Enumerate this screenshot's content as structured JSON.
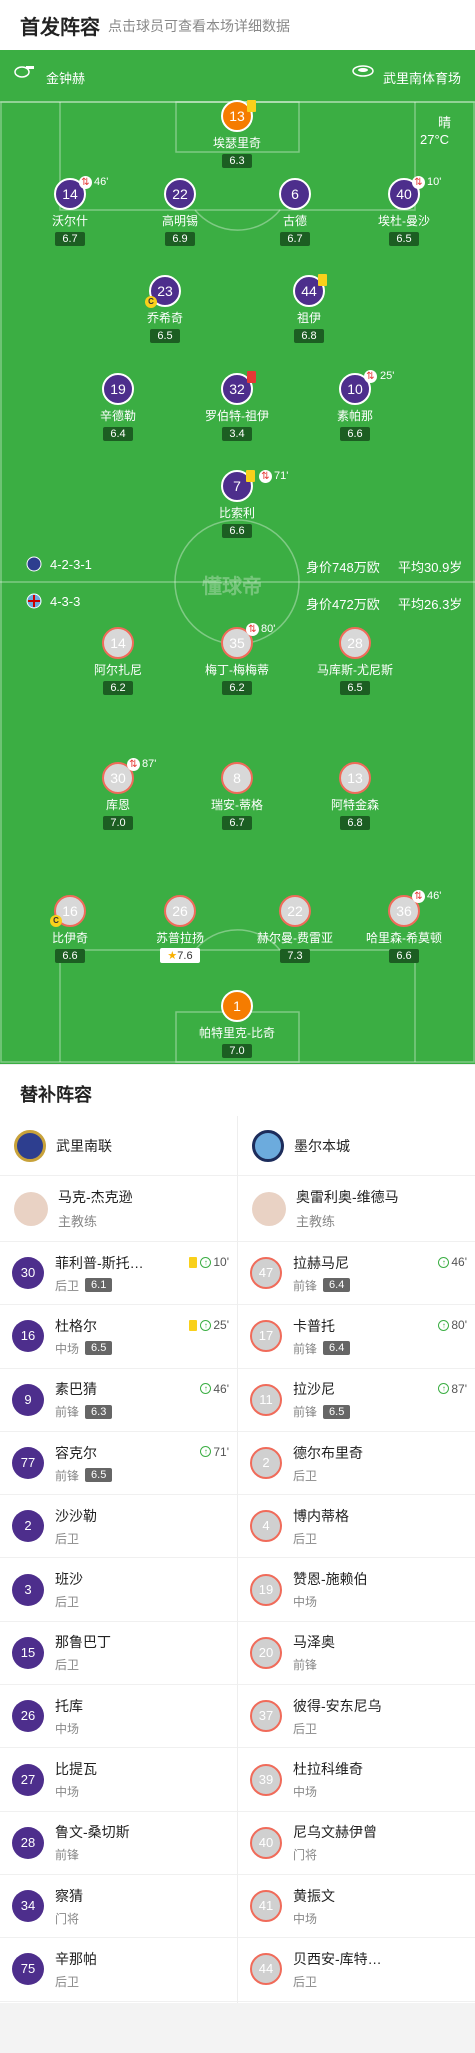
{
  "header": {
    "title": "首发阵容",
    "subtitle": "点击球员可查看本场详细数据"
  },
  "pitch": {
    "home_coach": "金钟赫",
    "stadium": "武里南体育场",
    "weather": "晴",
    "temperature": "27°C",
    "home_formation": "4-2-3-1",
    "home_value": "身价748万欧",
    "home_age": "平均30.9岁",
    "away_formation": "4-3-3",
    "away_value": "身价472万欧",
    "away_age": "平均26.3岁",
    "watermark": "懂球帝"
  },
  "home_players": [
    {
      "num": "13",
      "name": "埃瑟里奇",
      "rating": "6.3"
    },
    {
      "num": "14",
      "name": "沃尔什",
      "rating": "6.7",
      "sub": "46'"
    },
    {
      "num": "22",
      "name": "高明锡",
      "rating": "6.9"
    },
    {
      "num": "6",
      "name": "古德",
      "rating": "6.7"
    },
    {
      "num": "40",
      "name": "埃杜-曼沙",
      "rating": "6.5",
      "sub": "10'"
    },
    {
      "num": "23",
      "name": "乔希奇",
      "rating": "6.5"
    },
    {
      "num": "44",
      "name": "祖伊",
      "rating": "6.8"
    },
    {
      "num": "19",
      "name": "辛德勒",
      "rating": "6.4"
    },
    {
      "num": "32",
      "name": "罗伯特-祖伊",
      "rating": "3.4"
    },
    {
      "num": "10",
      "name": "素帕那",
      "rating": "6.6",
      "sub": "25'"
    },
    {
      "num": "7",
      "name": "比索利",
      "rating": "6.6",
      "sub": "71'"
    }
  ],
  "away_players": [
    {
      "num": "14",
      "name": "阿尔扎尼",
      "rating": "6.2"
    },
    {
      "num": "35",
      "name": "梅丁-梅梅蒂",
      "rating": "6.2",
      "sub": "80'"
    },
    {
      "num": "28",
      "name": "马库斯-尤尼斯",
      "rating": "6.5"
    },
    {
      "num": "30",
      "name": "库恩",
      "rating": "7.0",
      "sub": "87'"
    },
    {
      "num": "8",
      "name": "瑞安-蒂格",
      "rating": "6.7"
    },
    {
      "num": "13",
      "name": "阿特金森",
      "rating": "6.8"
    },
    {
      "num": "16",
      "name": "比伊奇",
      "rating": "6.6"
    },
    {
      "num": "26",
      "name": "苏普拉扬",
      "rating": "7.6"
    },
    {
      "num": "22",
      "name": "赫尔曼-费雷亚",
      "rating": "7.3"
    },
    {
      "num": "36",
      "name": "哈里森-希莫顿",
      "rating": "6.6",
      "sub": "46'"
    },
    {
      "num": "1",
      "name": "帕特里克-比奇",
      "rating": "7.0"
    }
  ],
  "subs": {
    "title": "替补阵容",
    "home_team": "武里南联",
    "away_team": "墨尔本城",
    "home_coach": "马克-杰克逊",
    "away_coach": "奥雷利奥-维德马",
    "coach_role": "主教练",
    "home": [
      {
        "num": "30",
        "name": "菲利普-斯托…",
        "pos": "后卫",
        "rating": "6.1",
        "yc": true,
        "in": "10'"
      },
      {
        "num": "16",
        "name": "杜格尔",
        "pos": "中场",
        "rating": "6.5",
        "yc": true,
        "in": "25'"
      },
      {
        "num": "9",
        "name": "素巴猜",
        "pos": "前锋",
        "rating": "6.3",
        "in": "46'"
      },
      {
        "num": "77",
        "name": "容克尔",
        "pos": "前锋",
        "rating": "6.5",
        "in": "71'"
      },
      {
        "num": "2",
        "name": "沙沙勒",
        "pos": "后卫"
      },
      {
        "num": "3",
        "name": "班沙",
        "pos": "后卫"
      },
      {
        "num": "15",
        "name": "那鲁巴丁",
        "pos": "后卫"
      },
      {
        "num": "26",
        "name": "托库",
        "pos": "中场"
      },
      {
        "num": "27",
        "name": "比提瓦",
        "pos": "中场"
      },
      {
        "num": "28",
        "name": "鲁文-桑切斯",
        "pos": "前锋"
      },
      {
        "num": "34",
        "name": "察猜",
        "pos": "门将"
      },
      {
        "num": "75",
        "name": "辛那帕",
        "pos": "后卫"
      }
    ],
    "away": [
      {
        "num": "47",
        "name": "拉赫马尼",
        "pos": "前锋",
        "rating": "6.4",
        "in": "46'"
      },
      {
        "num": "17",
        "name": "卡普托",
        "pos": "前锋",
        "rating": "6.4",
        "in": "80'"
      },
      {
        "num": "11",
        "name": "拉沙尼",
        "pos": "前锋",
        "rating": "6.5",
        "in": "87'"
      },
      {
        "num": "2",
        "name": "德尔布里奇",
        "pos": "后卫"
      },
      {
        "num": "4",
        "name": "博内蒂格",
        "pos": "后卫"
      },
      {
        "num": "19",
        "name": "赞恩-施赖伯",
        "pos": "中场"
      },
      {
        "num": "20",
        "name": "马泽奥",
        "pos": "前锋"
      },
      {
        "num": "37",
        "name": "彼得-安东尼乌",
        "pos": "后卫"
      },
      {
        "num": "39",
        "name": "杜拉科维奇",
        "pos": "中场"
      },
      {
        "num": "40",
        "name": "尼乌文赫伊曾",
        "pos": "门将"
      },
      {
        "num": "41",
        "name": "黄振文",
        "pos": "中场"
      },
      {
        "num": "44",
        "name": "贝西安-库特…",
        "pos": "后卫"
      }
    ]
  },
  "colors": {
    "pitch": "#3bae43",
    "home": "#4d2e8c",
    "away_ring": "#f06b5a",
    "gk": "#f57c00",
    "yellow": "#f9d01b",
    "red": "#e53935"
  }
}
